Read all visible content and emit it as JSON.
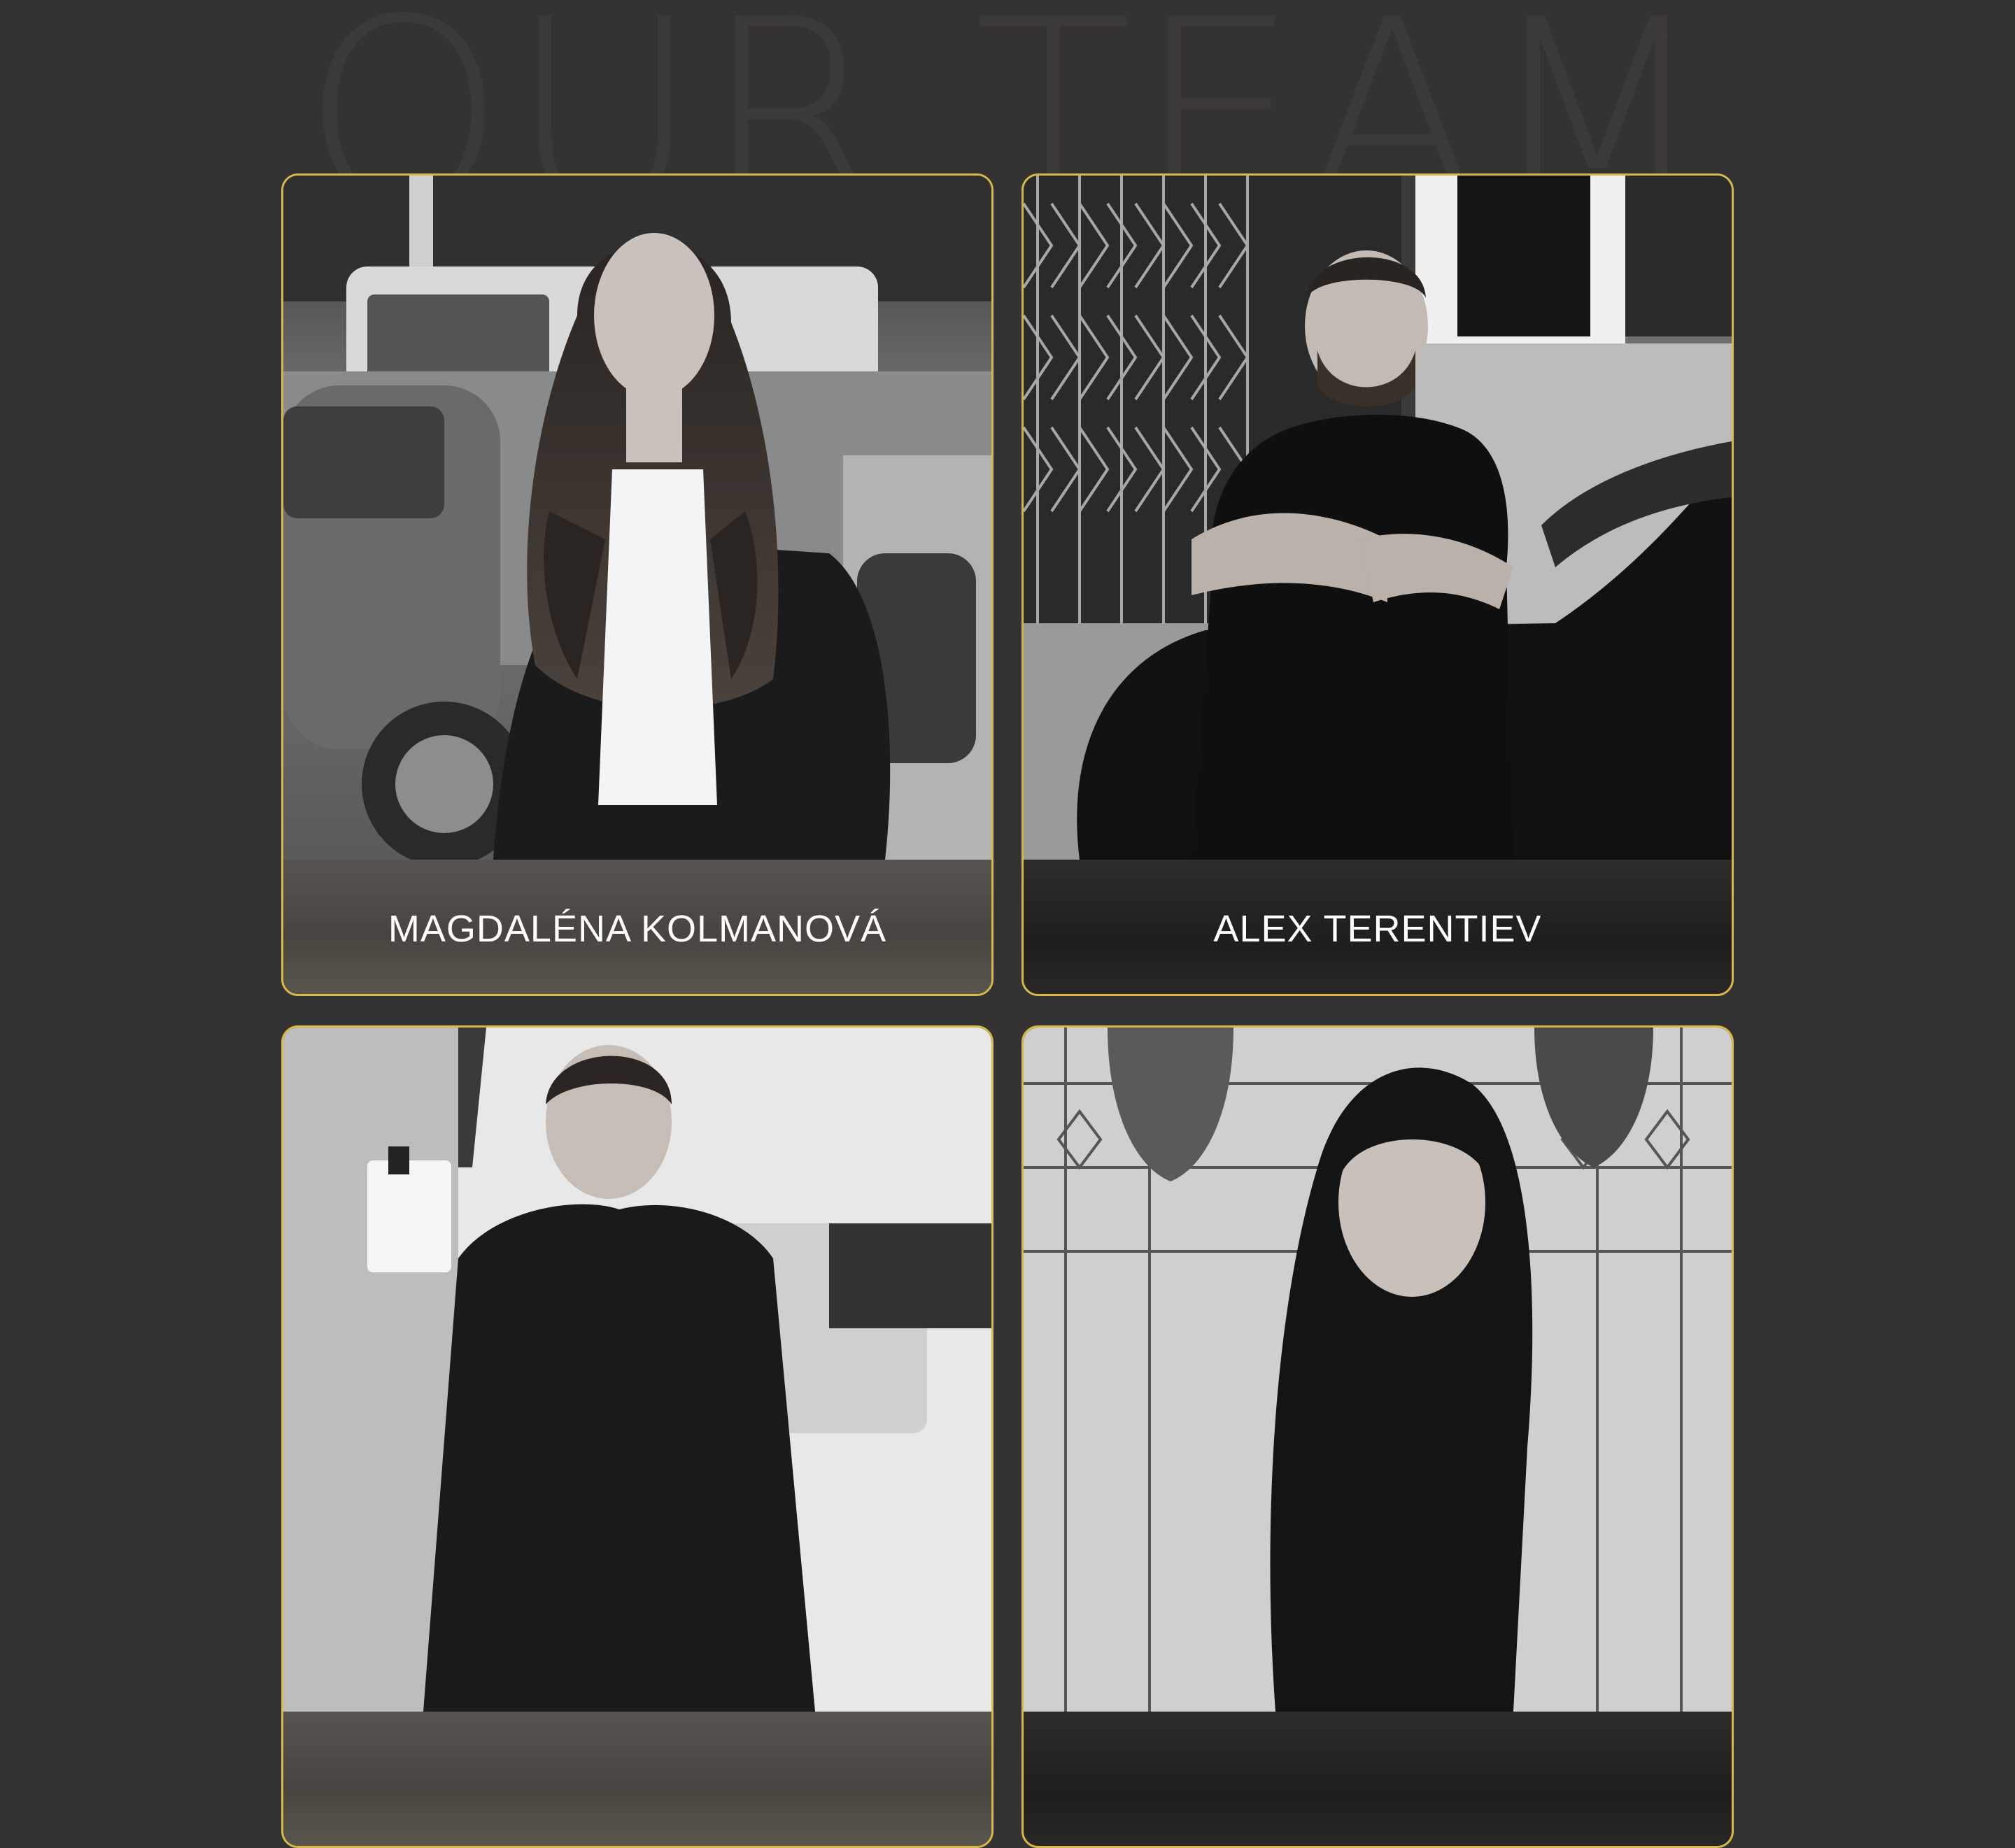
{
  "section": {
    "title": "OUR TEAM"
  },
  "members": [
    {
      "name": "MAGDALÉNA KOLMANOVÁ"
    },
    {
      "name": "ALEX TERENTIEV"
    },
    {
      "name": ""
    },
    {
      "name": ""
    }
  ],
  "colors": {
    "background": "#353233",
    "card_border": "#d7b948",
    "name_text": "#ffffff",
    "heading_watermark": "#3c393a"
  }
}
